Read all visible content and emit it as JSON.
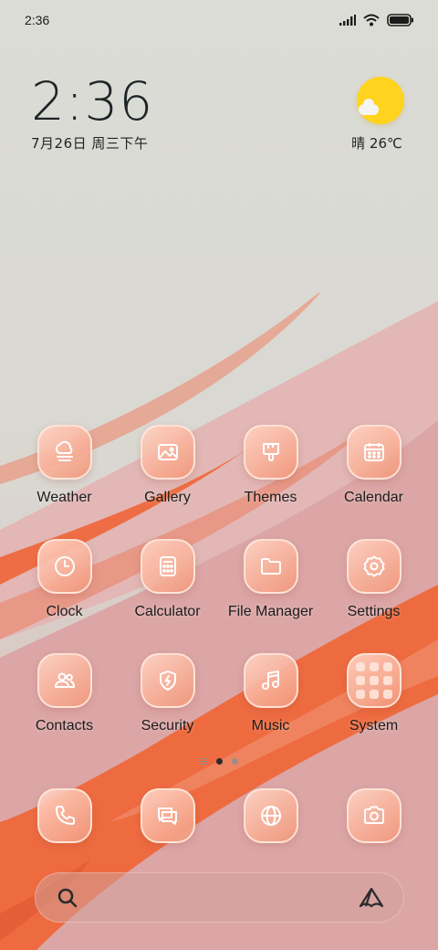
{
  "status_bar": {
    "time": "2:36"
  },
  "clock_widget": {
    "time": "2:36",
    "date": "7月26日 周三下午"
  },
  "weather_widget": {
    "condition_temp": "晴 26℃",
    "icon": "sunny-partly-cloudy-icon"
  },
  "apps": [
    {
      "label": "Weather",
      "icon": "cloud-fog-icon"
    },
    {
      "label": "Gallery",
      "icon": "image-icon"
    },
    {
      "label": "Themes",
      "icon": "paint-brush-icon"
    },
    {
      "label": "Calendar",
      "icon": "calendar-icon"
    },
    {
      "label": "Clock",
      "icon": "clock-icon"
    },
    {
      "label": "Calculator",
      "icon": "calculator-icon"
    },
    {
      "label": "File Manager",
      "icon": "folder-icon"
    },
    {
      "label": "Settings",
      "icon": "gear-icon"
    },
    {
      "label": "Contacts",
      "icon": "contacts-icon"
    },
    {
      "label": "Security",
      "icon": "shield-bolt-icon"
    },
    {
      "label": "Music",
      "icon": "music-note-icon"
    },
    {
      "label": "System",
      "icon": "folder-grid-icon"
    }
  ],
  "page_indicator": {
    "pages": 2,
    "current": 1
  },
  "dock": [
    {
      "name": "phone",
      "icon": "phone-icon"
    },
    {
      "name": "messages",
      "icon": "chat-bubbles-icon"
    },
    {
      "name": "browser",
      "icon": "globe-icon"
    },
    {
      "name": "camera",
      "icon": "camera-icon"
    }
  ],
  "search_bar": {
    "icon": "search-icon",
    "assistant_icon": "assistant-logo-icon"
  },
  "colors": {
    "icon_fill": "#f29b7d",
    "sun": "#ffd31e",
    "wallpaper_base": "#dcdcd6",
    "accent_orange": "#ee6a3e",
    "accent_pink": "#dca7a8"
  }
}
